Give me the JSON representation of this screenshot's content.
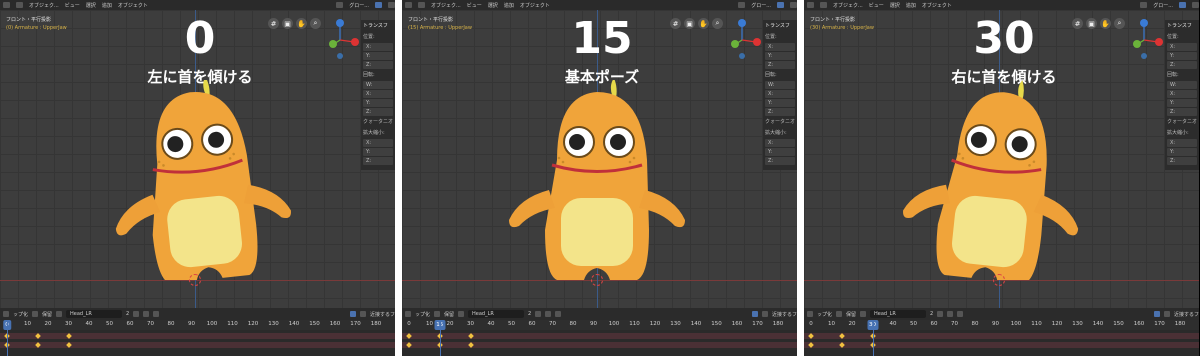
{
  "panels": [
    {
      "big_number": "0",
      "subtitle": "左に首を傾ける",
      "viewport_header": "フロント・平行投影",
      "active_object": "(0) Armature : UpperJaw",
      "current_frame": 0,
      "head_tilt": "left"
    },
    {
      "big_number": "15",
      "subtitle": "基本ポーズ",
      "viewport_header": "フロント・平行投影",
      "active_object": "(15) Armature : UpperJaw",
      "current_frame": 15,
      "head_tilt": "none"
    },
    {
      "big_number": "30",
      "subtitle": "右に首を傾ける",
      "viewport_header": "フロント・平行投影",
      "active_object": "(30) Armature : UpperJaw",
      "current_frame": 30,
      "head_tilt": "right"
    }
  ],
  "topbar": {
    "object_mode": "オブジェク...",
    "menu_view": "ビュー",
    "menu_select": "選択",
    "menu_add": "追加",
    "menu_object": "オブジェクト",
    "orientation": "グロー..."
  },
  "n_panel": {
    "header": "トランスフ",
    "location": "位置:",
    "rotation": "回転:",
    "quaternion": "クォータニオ",
    "scale": "拡大縮小:",
    "w": "W:",
    "x": "X:",
    "y": "Y:",
    "z": "Z:"
  },
  "timeline": {
    "keying": "キーフレ...",
    "keying_short": "ップ化",
    "keep": "保留",
    "action_name": "Head_LR",
    "users": "2",
    "snap": "近接するフ",
    "ticks": [
      "0",
      "10",
      "20",
      "30",
      "40",
      "50",
      "60",
      "70",
      "80",
      "90",
      "100",
      "110",
      "120",
      "130",
      "140",
      "150",
      "160",
      "170",
      "180"
    ],
    "keyframes": [
      0,
      15,
      30
    ]
  },
  "colors": {
    "character_body": "#f0a43a",
    "belly": "#f3e48a",
    "mouth": "#c0303a",
    "frame_highlight": "#4772b3",
    "keyframe": "#f0c040"
  }
}
